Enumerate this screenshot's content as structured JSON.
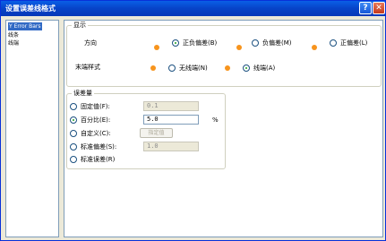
{
  "window": {
    "title": "设置误差线格式"
  },
  "titlebar": {
    "help": "?",
    "close": "✕"
  },
  "tree": {
    "items": [
      "Y Error Bars",
      "线条",
      "线端"
    ]
  },
  "display": {
    "title": "显示",
    "direction_label": "方向",
    "direction_options": [
      "正负偏差(B)",
      "负偏差(M)",
      "正偏差(L)"
    ],
    "direction_selected": "正负偏差(B)",
    "endstyle_label": "末端样式",
    "endstyle_options": [
      "无线端(N)",
      "线端(A)"
    ],
    "endstyle_selected": "线端(A)"
  },
  "amount": {
    "title": "误差量",
    "fixed_label": "固定值(F):",
    "fixed_value": "0.1",
    "percent_label": "百分比(E):",
    "percent_value": "5.0",
    "percent_unit": "%",
    "custom_label": "自定义(C):",
    "custom_button": "指定值",
    "stddev_label": "标准偏差(S):",
    "stddev_value": "1.0",
    "stderr_label": "标准误差(R)",
    "selected": "percent"
  },
  "colors": {
    "accent_dot": "#f7941d",
    "selection": "#316ac5"
  }
}
